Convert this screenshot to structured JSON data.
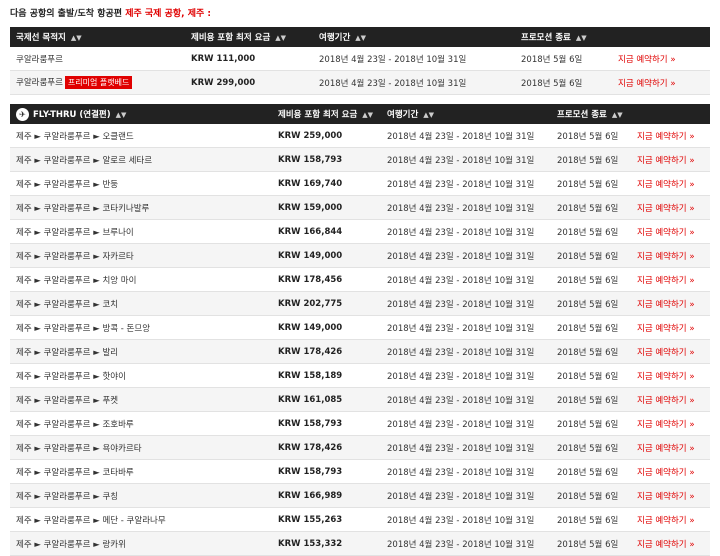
{
  "heading": {
    "prefix": "다음 공항의 출발/도착 항공편",
    "highlight": "제주 국제 공항, 제주 :"
  },
  "table1": {
    "headers": [
      "국제선 목적지",
      "제비용 포함 최저 요금",
      "여행기간",
      "프로모션 종료"
    ],
    "rows": [
      {
        "dest": "쿠알라룸푸르",
        "badge": "",
        "price": "KRW 111,000",
        "period": "2018년 4월 23일 - 2018년 10월 31일",
        "end": "2018년 5월 6일",
        "book": "지금 예약하기 »"
      },
      {
        "dest": "쿠알라룸푸르",
        "badge": "프리미엄 플랫베드",
        "price": "KRW 299,000",
        "period": "2018년 4월 23일 - 2018년 10월 31일",
        "end": "2018년 5월 6일",
        "book": "지금 예약하기 »"
      }
    ]
  },
  "table2": {
    "headers": [
      "FLY-THRU (연결편)",
      "제비용 포함 최저 요금",
      "여행기간",
      "프로모션 종료"
    ],
    "logo_icon": "airline-logo-icon",
    "rows": [
      {
        "route": "제주 ► 쿠알라룸푸르 ► 오클랜드",
        "price": "KRW 259,000",
        "period": "2018년 4월 23일 - 2018년 10월 31일",
        "end": "2018년 5월 6일",
        "book": "지금 예약하기 »"
      },
      {
        "route": "제주 ► 쿠알라룸푸르 ► 알로르 세타르",
        "price": "KRW 158,793",
        "period": "2018년 4월 23일 - 2018년 10월 31일",
        "end": "2018년 5월 6일",
        "book": "지금 예약하기 »"
      },
      {
        "route": "제주 ► 쿠알라룸푸르 ► 반둥",
        "price": "KRW 169,740",
        "period": "2018년 4월 23일 - 2018년 10월 31일",
        "end": "2018년 5월 6일",
        "book": "지금 예약하기 »"
      },
      {
        "route": "제주 ► 쿠알라룸푸르 ► 코타키나발루",
        "price": "KRW 159,000",
        "period": "2018년 4월 23일 - 2018년 10월 31일",
        "end": "2018년 5월 6일",
        "book": "지금 예약하기 »"
      },
      {
        "route": "제주 ► 쿠알라룸푸르 ► 브루나이",
        "price": "KRW 166,844",
        "period": "2018년 4월 23일 - 2018년 10월 31일",
        "end": "2018년 5월 6일",
        "book": "지금 예약하기 »"
      },
      {
        "route": "제주 ► 쿠알라룸푸르 ► 자카르타",
        "price": "KRW 149,000",
        "period": "2018년 4월 23일 - 2018년 10월 31일",
        "end": "2018년 5월 6일",
        "book": "지금 예약하기 »"
      },
      {
        "route": "제주 ► 쿠알라룸푸르 ► 치앙 마이",
        "price": "KRW 178,456",
        "period": "2018년 4월 23일 - 2018년 10월 31일",
        "end": "2018년 5월 6일",
        "book": "지금 예약하기 »"
      },
      {
        "route": "제주 ► 쿠알라룸푸르 ► 코치",
        "price": "KRW 202,775",
        "period": "2018년 4월 23일 - 2018년 10월 31일",
        "end": "2018년 5월 6일",
        "book": "지금 예약하기 »"
      },
      {
        "route": "제주 ► 쿠알라룸푸르 ► 방콕 - 돈므앙",
        "price": "KRW 149,000",
        "period": "2018년 4월 23일 - 2018년 10월 31일",
        "end": "2018년 5월 6일",
        "book": "지금 예약하기 »"
      },
      {
        "route": "제주 ► 쿠알라룸푸르 ► 발리",
        "price": "KRW 178,426",
        "period": "2018년 4월 23일 - 2018년 10월 31일",
        "end": "2018년 5월 6일",
        "book": "지금 예약하기 »"
      },
      {
        "route": "제주 ► 쿠알라룸푸르 ► 핫야이",
        "price": "KRW 158,189",
        "period": "2018년 4월 23일 - 2018년 10월 31일",
        "end": "2018년 5월 6일",
        "book": "지금 예약하기 »"
      },
      {
        "route": "제주 ► 쿠알라룸푸르 ► 푸켓",
        "price": "KRW 161,085",
        "period": "2018년 4월 23일 - 2018년 10월 31일",
        "end": "2018년 5월 6일",
        "book": "지금 예약하기 »"
      },
      {
        "route": "제주 ► 쿠알라룸푸르 ► 조호바루",
        "price": "KRW 158,793",
        "period": "2018년 4월 23일 - 2018년 10월 31일",
        "end": "2018년 5월 6일",
        "book": "지금 예약하기 »"
      },
      {
        "route": "제주 ► 쿠알라룸푸르 ► 욕야카르타",
        "price": "KRW 178,426",
        "period": "2018년 4월 23일 - 2018년 10월 31일",
        "end": "2018년 5월 6일",
        "book": "지금 예약하기 »"
      },
      {
        "route": "제주 ► 쿠알라룸푸르 ► 코타바루",
        "price": "KRW 158,793",
        "period": "2018년 4월 23일 - 2018년 10월 31일",
        "end": "2018년 5월 6일",
        "book": "지금 예약하기 »"
      },
      {
        "route": "제주 ► 쿠알라룸푸르 ► 쿠칭",
        "price": "KRW 166,989",
        "period": "2018년 4월 23일 - 2018년 10월 31일",
        "end": "2018년 5월 6일",
        "book": "지금 예약하기 »"
      },
      {
        "route": "제주 ► 쿠알라룸푸르 ► 메단 - 쿠알라나무",
        "price": "KRW 155,263",
        "period": "2018년 4월 23일 - 2018년 10월 31일",
        "end": "2018년 5월 6일",
        "book": "지금 예약하기 »"
      },
      {
        "route": "제주 ► 쿠알라룸푸르 ► 랑카위",
        "price": "KRW 153,332",
        "period": "2018년 4월 23일 - 2018년 10월 31일",
        "end": "2018년 5월 6일",
        "book": "지금 예약하기 »"
      }
    ]
  }
}
